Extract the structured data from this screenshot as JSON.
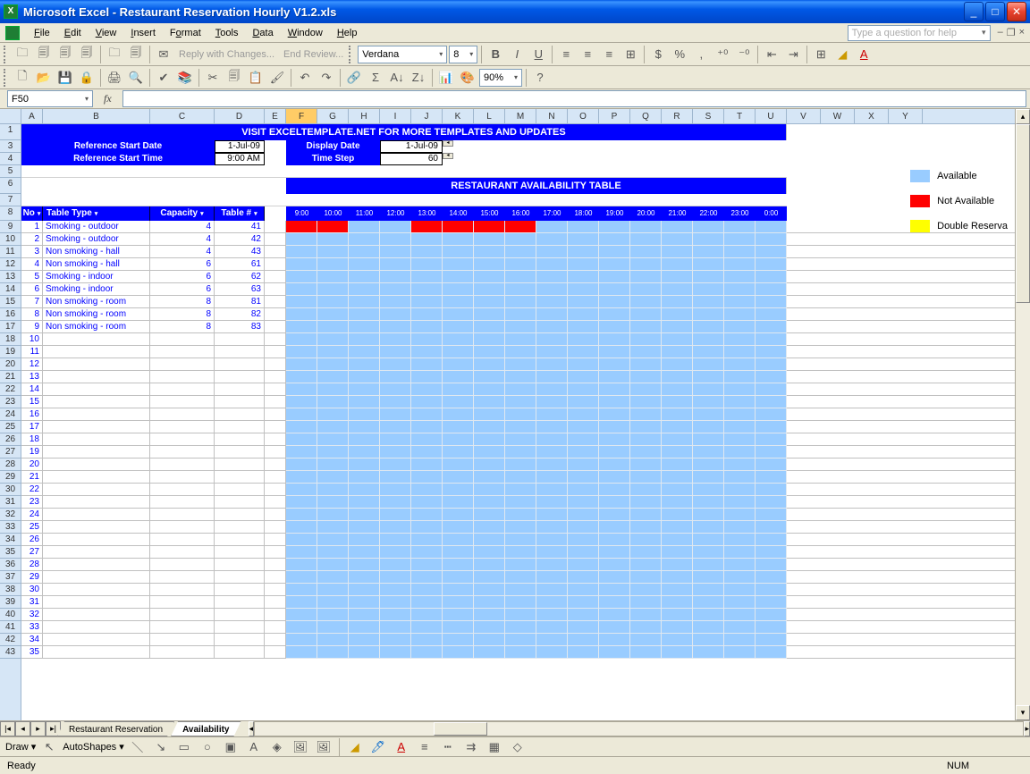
{
  "app": {
    "title": "Microsoft Excel - Restaurant Reservation Hourly V1.2.xls"
  },
  "menu": {
    "file": "File",
    "edit": "Edit",
    "view": "View",
    "insert": "Insert",
    "format": "Format",
    "tools": "Tools",
    "data": "Data",
    "window": "Window",
    "help": "Help"
  },
  "helpbox": {
    "placeholder": "Type a question for help"
  },
  "toolbar": {
    "reply": "Reply with Changes...",
    "endreview": "End Review...",
    "font": "Verdana",
    "size": "8",
    "zoom": "90%"
  },
  "namebox": "F50",
  "columns": [
    "A",
    "B",
    "C",
    "D",
    "E",
    "F",
    "G",
    "H",
    "I",
    "J",
    "K",
    "L",
    "M",
    "N",
    "O",
    "P",
    "Q",
    "R",
    "S",
    "T",
    "U",
    "V",
    "W",
    "X",
    "Y"
  ],
  "selectedCol": "F",
  "rows": [
    1,
    3,
    4,
    5,
    6,
    7,
    8,
    9,
    10,
    11,
    12,
    13,
    14,
    15,
    16,
    17,
    18,
    19,
    20,
    21,
    22,
    23,
    24,
    25,
    26,
    27,
    28,
    29,
    30,
    31,
    32,
    33,
    34,
    35,
    36,
    37,
    38,
    39,
    40,
    41,
    42,
    43
  ],
  "banner1": "VISIT EXCELTEMPLATE.NET FOR MORE TEMPLATES AND UPDATES",
  "ref": {
    "startDateLbl": "Reference Start Date",
    "startDate": "1-Jul-09",
    "startTimeLbl": "Reference Start Time",
    "startTime": "9:00 AM",
    "displayDateLbl": "Display Date",
    "displayDate": "1-Jul-09",
    "timeStepLbl": "Time Step",
    "timeStep": "60"
  },
  "banner2": "RESTAURANT AVAILABILITY TABLE",
  "headers": {
    "no": "No",
    "tableType": "Table Type",
    "capacity": "Capacity",
    "table": "Table #"
  },
  "times": [
    "9:00",
    "10:00",
    "11:00",
    "12:00",
    "13:00",
    "14:00",
    "15:00",
    "16:00",
    "17:00",
    "18:00",
    "19:00",
    "20:00",
    "21:00",
    "22:00",
    "23:00",
    "0:00"
  ],
  "tables": [
    {
      "no": 1,
      "type": "Smoking - outdoor",
      "cap": 4,
      "num": 41,
      "slots": [
        1,
        1,
        0,
        0,
        1,
        1,
        1,
        1,
        0,
        0,
        0,
        0,
        0,
        0,
        0,
        0
      ]
    },
    {
      "no": 2,
      "type": "Smoking - outdoor",
      "cap": 4,
      "num": 42,
      "slots": [
        0,
        0,
        0,
        0,
        0,
        0,
        0,
        0,
        0,
        0,
        0,
        0,
        0,
        0,
        0,
        0
      ]
    },
    {
      "no": 3,
      "type": "Non smoking - hall",
      "cap": 4,
      "num": 43,
      "slots": [
        0,
        0,
        0,
        0,
        0,
        0,
        0,
        0,
        0,
        0,
        0,
        0,
        0,
        0,
        0,
        0
      ]
    },
    {
      "no": 4,
      "type": "Non smoking - hall",
      "cap": 6,
      "num": 61,
      "slots": [
        0,
        0,
        0,
        0,
        0,
        0,
        0,
        0,
        0,
        0,
        0,
        0,
        0,
        0,
        0,
        0
      ]
    },
    {
      "no": 5,
      "type": "Smoking - indoor",
      "cap": 6,
      "num": 62,
      "slots": [
        0,
        0,
        0,
        0,
        0,
        0,
        0,
        0,
        0,
        0,
        0,
        0,
        0,
        0,
        0,
        0
      ]
    },
    {
      "no": 6,
      "type": "Smoking - indoor",
      "cap": 6,
      "num": 63,
      "slots": [
        0,
        0,
        0,
        0,
        0,
        0,
        0,
        0,
        0,
        0,
        0,
        0,
        0,
        0,
        0,
        0
      ]
    },
    {
      "no": 7,
      "type": "Non smoking - room",
      "cap": 8,
      "num": 81,
      "slots": [
        0,
        0,
        0,
        0,
        0,
        0,
        0,
        0,
        0,
        0,
        0,
        0,
        0,
        0,
        0,
        0
      ]
    },
    {
      "no": 8,
      "type": "Non smoking - room",
      "cap": 8,
      "num": 82,
      "slots": [
        0,
        0,
        0,
        0,
        0,
        0,
        0,
        0,
        0,
        0,
        0,
        0,
        0,
        0,
        0,
        0
      ]
    },
    {
      "no": 9,
      "type": "Non smoking - room",
      "cap": 8,
      "num": 83,
      "slots": [
        0,
        0,
        0,
        0,
        0,
        0,
        0,
        0,
        0,
        0,
        0,
        0,
        0,
        0,
        0,
        0
      ]
    }
  ],
  "emptyRows": [
    10,
    11,
    12,
    13,
    14,
    15,
    16,
    17,
    18,
    19,
    20,
    21,
    22,
    23,
    24,
    25,
    26,
    27,
    28,
    29,
    30,
    31,
    32,
    33,
    34,
    35
  ],
  "legend": {
    "avail": "Available",
    "navail": "Not Available",
    "dbl": "Double Reserva"
  },
  "colors": {
    "avail": "#99ccff",
    "navail": "#ff0000",
    "dbl": "#ffff00"
  },
  "sheets": {
    "s1": "Restaurant Reservation",
    "s2": "Availability"
  },
  "draw": {
    "label": "Draw",
    "autoshapes": "AutoShapes"
  },
  "status": {
    "ready": "Ready",
    "num": "NUM"
  }
}
